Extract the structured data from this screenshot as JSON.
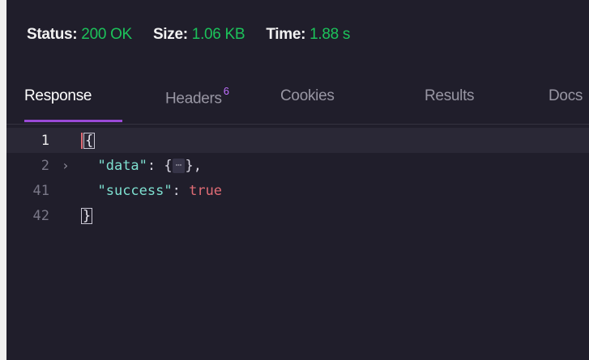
{
  "status": {
    "status_label": "Status:",
    "status_value": "200 OK",
    "size_label": "Size:",
    "size_value": "1.06 KB",
    "time_label": "Time:",
    "time_value": "1.88 s"
  },
  "tabs": [
    {
      "label": "Response",
      "active": true
    },
    {
      "label": "Headers",
      "count": "6"
    },
    {
      "label": "Cookies"
    },
    {
      "label": "Results"
    },
    {
      "label": "Docs"
    }
  ],
  "editor": {
    "lines": [
      {
        "num": "1",
        "text": "{"
      },
      {
        "num": "2",
        "key": "\"data\"",
        "colon": ": ",
        "open": "{",
        "collapsed": "⋯",
        "close": "},"
      },
      {
        "num": "41",
        "key": "\"success\"",
        "colon": ": ",
        "value": "true"
      },
      {
        "num": "42",
        "text": "}"
      }
    ]
  },
  "colors": {
    "background": "#201e2b",
    "status_ok": "#1cc25a",
    "active_tab_underline": "#9a4ad6",
    "json_key": "#7ee0d0",
    "json_bool": "#e06c75"
  }
}
